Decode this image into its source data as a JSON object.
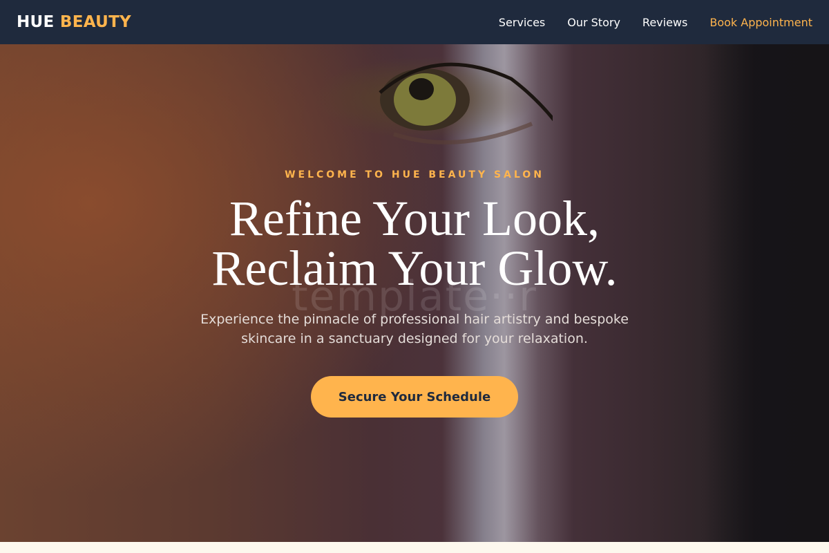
{
  "header": {
    "logo_primary": "HUE",
    "logo_accent": "BEAUTY",
    "nav": [
      {
        "label": "Services"
      },
      {
        "label": "Our Story"
      },
      {
        "label": "Reviews"
      },
      {
        "label": "Book Appointment"
      }
    ]
  },
  "hero": {
    "eyebrow": "WELCOME TO HUE BEAUTY SALON",
    "headline_line1": "Refine Your Look,",
    "headline_line2": "Reclaim Your Glow.",
    "watermark": "template··r",
    "subtitle": "Experience the pinnacle of professional hair artistry and bespoke skincare in a sanctuary designed for your relaxation.",
    "cta_label": "Secure Your Schedule"
  },
  "colors": {
    "navbar_bg": "#1f2a3d",
    "accent": "#ffb44d",
    "page_bg": "#fdf8ee"
  }
}
